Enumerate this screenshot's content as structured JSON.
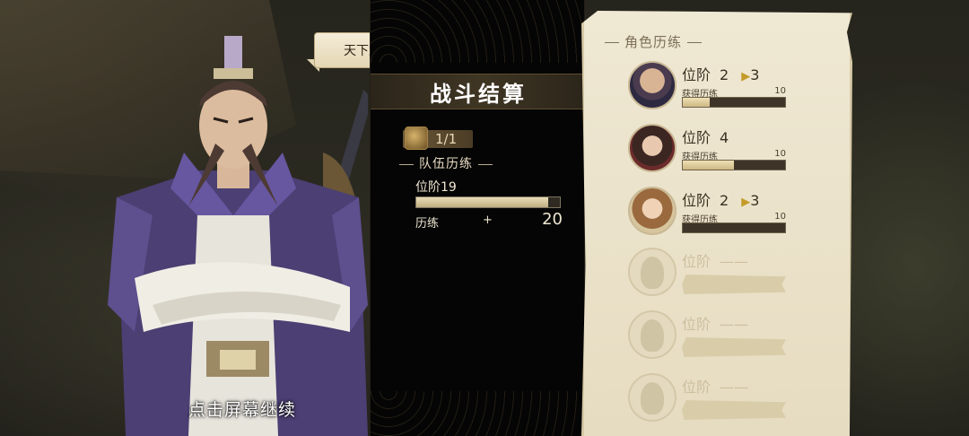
{
  "speech_bubble": "天下武功，唯快不破！",
  "battle_result": {
    "title": "战斗结算",
    "counter": "1/1",
    "team_section_label": "队伍历练",
    "team_rank_label": "位阶",
    "team_rank_value": "19",
    "team_xp_progress": 0.92,
    "team_xp_label": "历练",
    "team_xp_plus": "+",
    "team_xp_value": "20"
  },
  "role_panel": {
    "title": "角色历练",
    "rank_label": "位阶",
    "gain_label": "获得历练",
    "empty_rank": "——",
    "characters": [
      {
        "rank": "2",
        "next_rank": "3",
        "gain": "10",
        "progress": 0.26,
        "avatar": "bearded-man-avatar"
      },
      {
        "rank": "4",
        "next_rank": "",
        "gain": "10",
        "progress": 0.5,
        "avatar": "woman-avatar"
      },
      {
        "rank": "2",
        "next_rank": "3",
        "gain": "10",
        "progress": 0.0,
        "avatar": "girl-avatar"
      },
      {
        "empty": true
      },
      {
        "empty": true
      },
      {
        "empty": true
      }
    ]
  },
  "continue_hint": "点击屏幕继续",
  "colors": {
    "parchment": "#e9dfc5",
    "panel": "#050505",
    "accent_gold": "#c49a2a"
  }
}
